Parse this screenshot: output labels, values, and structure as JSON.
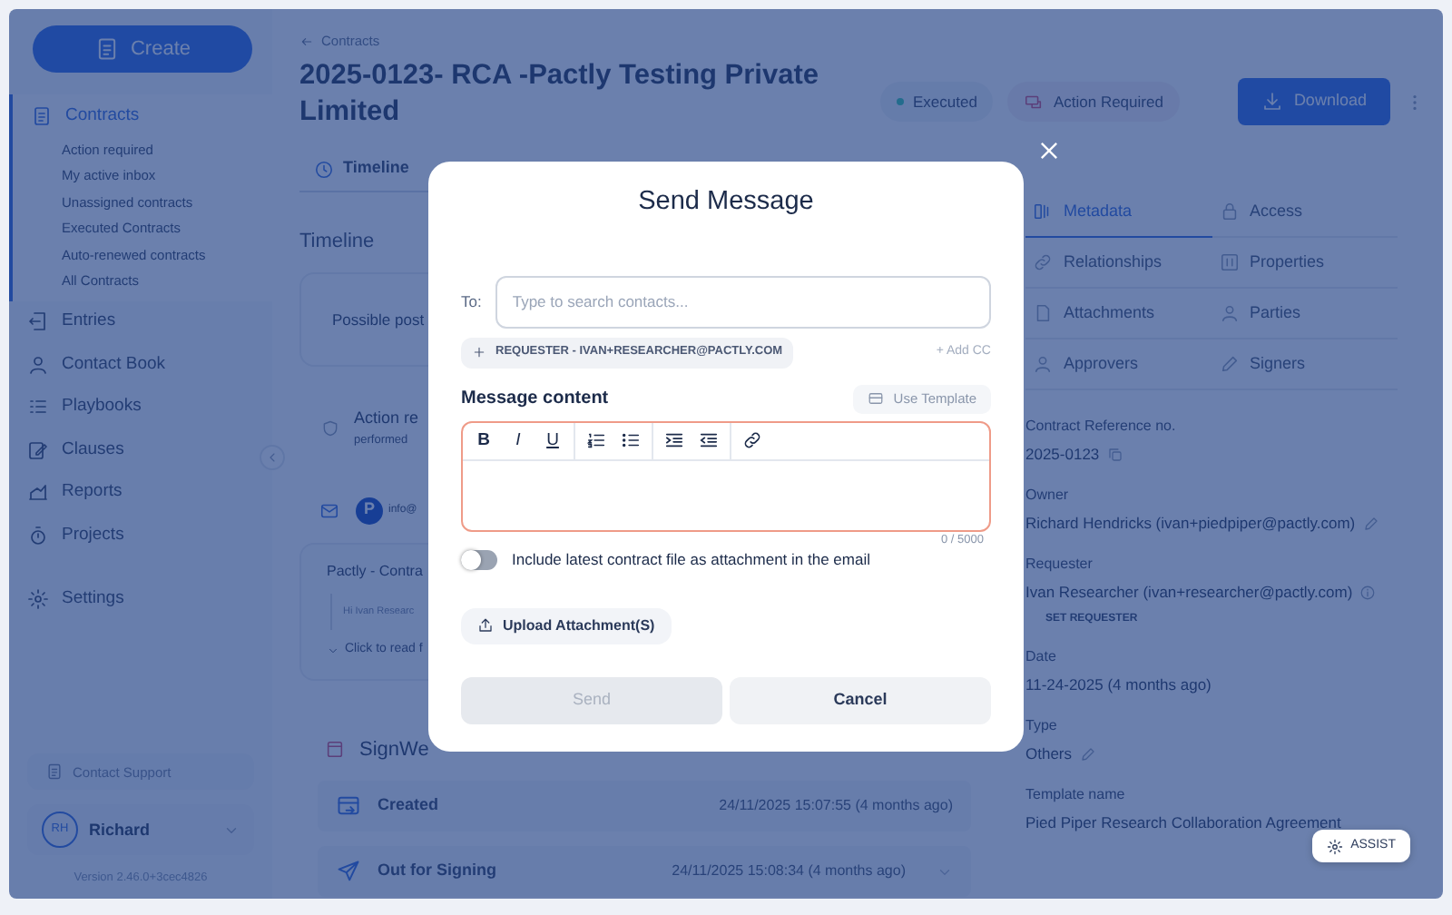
{
  "sidebar": {
    "create_button": "Create",
    "nav": [
      {
        "label": "Contracts",
        "selected": true,
        "children": [
          {
            "label": "Action required"
          },
          {
            "label": "My active inbox"
          },
          {
            "label": "Unassigned contracts"
          },
          {
            "label": "Executed Contracts"
          },
          {
            "label": "Auto-renewed contracts"
          },
          {
            "label": "All Contracts"
          }
        ]
      },
      {
        "label": "Entries",
        "selected": false
      },
      {
        "label": "Contact Book",
        "selected": false
      },
      {
        "label": "Playbooks",
        "selected": false
      },
      {
        "label": "Clauses",
        "selected": false
      },
      {
        "label": "Reports",
        "selected": false
      },
      {
        "label": "Projects",
        "selected": false
      },
      {
        "label": "Settings",
        "selected": false
      }
    ],
    "support": "Contact Support",
    "user": {
      "initials": "RH",
      "name": "Richard"
    },
    "version": "Version 2.46.0+3cec4826"
  },
  "header": {
    "breadcrumb": "Contracts",
    "title": "2025-0123- RCA -Pactly Testing Private Limited",
    "status": "Executed",
    "action": "Action Required",
    "download": "Download"
  },
  "tabs": [
    {
      "label": "Timeline",
      "selected": true
    }
  ],
  "timeline": {
    "heading": "Timeline",
    "notice": "Possible post",
    "action_title": "Action re",
    "action_sub": "performed",
    "email_avatar": "P",
    "email_from": "info@",
    "email_subject": "Pactly - Contra",
    "email_preview": "Hi Ivan Researc",
    "read_more": "Click to read f",
    "provider": "SignWe",
    "events": [
      {
        "label": "Created",
        "time": "24/11/2025 15:07:55 (4 months ago)",
        "expandable": false
      },
      {
        "label": "Out for Signing",
        "time": "24/11/2025 15:08:34 (4 months ago)",
        "expandable": true
      }
    ]
  },
  "panel": {
    "tabs": [
      {
        "label": "Metadata",
        "selected": true
      },
      {
        "label": "Access",
        "selected": false
      },
      {
        "label": "Relationships",
        "selected": false
      },
      {
        "label": "Properties",
        "selected": false
      },
      {
        "label": "Attachments",
        "selected": false
      },
      {
        "label": "Parties",
        "selected": false
      },
      {
        "label": "Approvers",
        "selected": false
      },
      {
        "label": "Signers",
        "selected": false
      }
    ],
    "fields": [
      {
        "label": "Contract Reference no.",
        "value": "2025-0123",
        "kind": "copy"
      },
      {
        "label": "Owner",
        "value": "Richard Hendricks (ivan+piedpiper@pactly.com)",
        "kind": "edit"
      },
      {
        "label": "Requester",
        "value": "Ivan Researcher (ivan+researcher@pactly.com)",
        "kind": "info",
        "action": "SET REQUESTER"
      },
      {
        "label": "Date",
        "value": "11-24-2025 (4 months ago)",
        "kind": "plain"
      },
      {
        "label": "Type",
        "value": "Others",
        "kind": "edit"
      },
      {
        "label": "Template name",
        "value": "Pied Piper Research Collaboration Agreement",
        "kind": "plain"
      }
    ],
    "assist": "ASSIST"
  },
  "modal": {
    "title": "Send Message",
    "to_label": "To:",
    "to_placeholder": "Type to search contacts...",
    "suggestion": "REQUESTER - IVAN+RESEARCHER@PACTLY.COM",
    "add_cc": "+ Add CC",
    "content_label": "Message content",
    "use_template": "Use Template",
    "toolbar_groups": [
      [
        {
          "kind": "bold",
          "glyph": "B"
        },
        {
          "kind": "italic",
          "glyph": "I"
        },
        {
          "kind": "underline",
          "glyph": "U"
        }
      ],
      [
        {
          "kind": "ordered-list"
        },
        {
          "kind": "bullet-list"
        }
      ],
      [
        {
          "kind": "indent"
        },
        {
          "kind": "outdent"
        }
      ],
      [
        {
          "kind": "link"
        }
      ]
    ],
    "editor_invalid": true,
    "counter": "0 / 5000",
    "attach_toggle": {
      "label": "Include latest contract file as attachment in the email",
      "on": false
    },
    "upload": "Upload Attachment(S)",
    "send": {
      "label": "Send",
      "disabled": true
    },
    "cancel": "Cancel"
  }
}
